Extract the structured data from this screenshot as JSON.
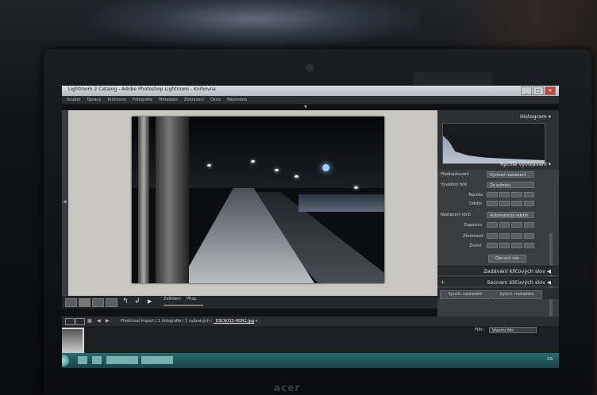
{
  "window": {
    "title": "Lightroom 2 Catalog - Adobe Photoshop Lightroom - Knihovna",
    "controls": [
      "_",
      "□",
      "✕"
    ]
  },
  "menu": [
    "Soubor",
    "Úpravy",
    "Knihovna",
    "Fotografie",
    "Metadata",
    "Zobrazení",
    "Okno",
    "Nápověda"
  ],
  "right_panel": {
    "histogram_label": "Histogram",
    "quick_develop_label": "Rychlé vyvolávání",
    "preset_label": "Přednastavení",
    "preset_value": "Výchozí nastavení",
    "white_balance_label": "Vyvážení bílé",
    "white_balance_value": "Ze snímku",
    "temperature_label": "Teplota",
    "tint_label": "Odstín",
    "tone_label": "Nastavení tónů",
    "tone_auto": "Automatický odstín",
    "exposure_label": "Expozice",
    "clarity_label": "Zřetelnost",
    "vibrance_label": "Živost",
    "reset_button": "Obnovit vše",
    "keywording_label": "Zadávání klíčových slov",
    "keyword_list_label": "Seznam klíčových slov",
    "keyword_list_add": "+",
    "sync_settings": "Synch. nastavení",
    "sync_metadata": "Synch. metadata"
  },
  "toolbar": {
    "zoom_label": "Zvětšení",
    "fit_label": "Přizp."
  },
  "filmstrip": {
    "path_prefix": "Předchozí import / 1 fotografie / 1 vybraných /",
    "filename": "_DSC6033-HDR2.jpg",
    "filter_label": "Filtr:",
    "filter_value": "Vlastní filtr"
  },
  "taskbar": {
    "tray_text": "CS"
  },
  "laptop": {
    "brand": "acer"
  }
}
